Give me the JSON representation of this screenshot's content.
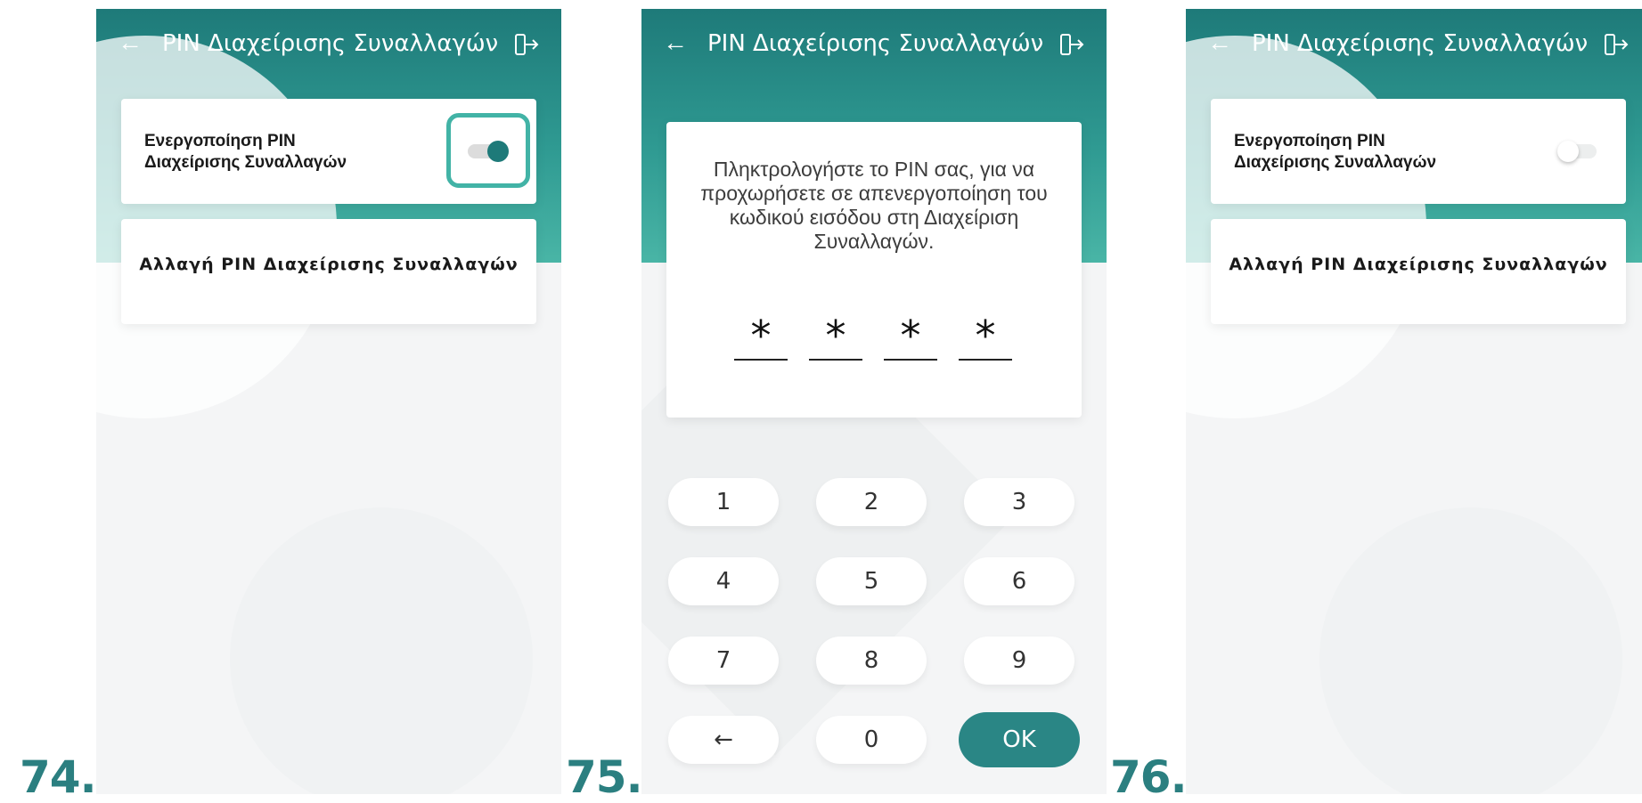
{
  "screens": [
    {
      "step": "74.",
      "title": "PIN Διαχείρισης Συναλλαγών",
      "toggle_label_line1": "Ενεργοποίηση PIN",
      "toggle_label_line2": "Διαχείρισης Συναλλαγών",
      "toggle_state": "on",
      "change_pin_label": "Αλλαγή PIN Διαχείρισης Συναλλαγών"
    },
    {
      "step": "75.",
      "title": "PIN Διαχείρισης Συναλλαγών",
      "prompt": "Πληκτρολογήστε το PIN σας, για να προχωρήσετε σε απενεργοποίηση του κωδικού εισόδου στη Διαχείριση Συναλλαγών.",
      "pin_digits": [
        "*",
        "*",
        "*",
        "*"
      ],
      "keypad": [
        "1",
        "2",
        "3",
        "4",
        "5",
        "6",
        "7",
        "8",
        "9",
        "←",
        "0",
        "OK"
      ]
    },
    {
      "step": "76.",
      "title": "PIN Διαχείρισης Συναλλαγών",
      "toggle_label_line1": "Ενεργοποίηση PIN",
      "toggle_label_line2": "Διαχείρισης Συναλλαγών",
      "toggle_state": "off",
      "change_pin_label": "Αλλαγή PIN Διαχείρισης Συναλλαγών"
    }
  ],
  "icons": {
    "back": "arrow-left-icon",
    "exit": "logout-door-icon"
  },
  "colors": {
    "accent": "#1e7a79",
    "highlight": "#42b3a6",
    "step_number": "#2b7f80",
    "ok_button": "#2a8685"
  }
}
